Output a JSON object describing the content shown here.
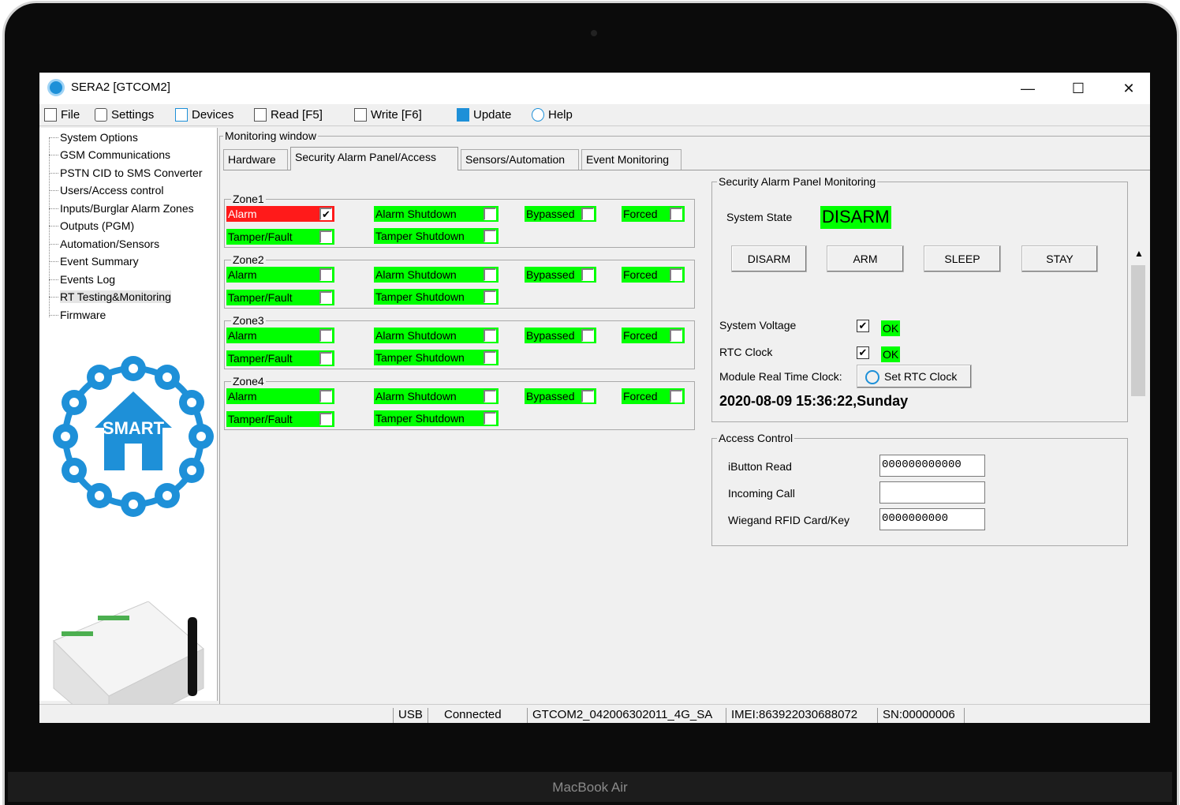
{
  "window": {
    "title": "SERA2 [GTCOM2]",
    "minimize": "—",
    "maximize": "☐",
    "close": "✕"
  },
  "menu": [
    {
      "label": "File",
      "icon": "file-icon"
    },
    {
      "label": "Settings",
      "icon": "settings-icon"
    },
    {
      "label": "Devices",
      "icon": "devices-icon"
    },
    {
      "label": "Read [F5]",
      "icon": "read-icon"
    },
    {
      "label": "Write [F6]",
      "icon": "write-icon"
    },
    {
      "label": "Update",
      "icon": "update-icon"
    },
    {
      "label": "Help",
      "icon": "help-icon"
    }
  ],
  "tree": [
    "System Options",
    "GSM Communications",
    "PSTN CID to SMS Converter",
    "Users/Access control",
    "Inputs/Burglar Alarm Zones",
    "Outputs (PGM)",
    "Automation/Sensors",
    "Event Summary",
    "Events Log",
    "RT Testing&Monitoring",
    "Firmware"
  ],
  "logo": {
    "text": "SMART"
  },
  "monitor": {
    "title": "Monitoring window"
  },
  "tabs": [
    "Hardware",
    "Security Alarm Panel/Access",
    "Sensors/Automation",
    "Event Monitoring"
  ],
  "zones": [
    {
      "name": "Zone1",
      "alarm": "Alarm",
      "alarm_checked": "✔",
      "tamper": "Tamper/Fault",
      "alarm_shutdown": "Alarm Shutdown",
      "tamper_shutdown": "Tamper Shutdown",
      "bypassed": "Bypassed",
      "forced": "Forced"
    },
    {
      "name": "Zone2",
      "alarm": "Alarm",
      "alarm_checked": "",
      "tamper": "Tamper/Fault",
      "alarm_shutdown": "Alarm Shutdown",
      "tamper_shutdown": "Tamper Shutdown",
      "bypassed": "Bypassed",
      "forced": "Forced"
    },
    {
      "name": "Zone3",
      "alarm": "Alarm",
      "alarm_checked": "",
      "tamper": "Tamper/Fault",
      "alarm_shutdown": "Alarm Shutdown",
      "tamper_shutdown": "Tamper Shutdown",
      "bypassed": "Bypassed",
      "forced": "Forced"
    },
    {
      "name": "Zone4",
      "alarm": "Alarm",
      "alarm_checked": "",
      "tamper": "Tamper/Fault",
      "alarm_shutdown": "Alarm Shutdown",
      "tamper_shutdown": "Tamper Shutdown",
      "bypassed": "Bypassed",
      "forced": "Forced"
    }
  ],
  "panel": {
    "title": "Security Alarm Panel Monitoring",
    "state_label": "System State",
    "state_value": "DISARM",
    "buttons": [
      "DISARM",
      "ARM",
      "SLEEP",
      "STAY"
    ],
    "voltage_label": "System Voltage",
    "voltage_checked": "✔",
    "voltage_value": "OK",
    "rtc_label": "RTC Clock",
    "rtc_checked": "✔",
    "rtc_value": "OK",
    "module_clock_label": "Module Real Time Clock:",
    "set_rtc": "Set RTC Clock",
    "datetime": "2020-08-09 15:36:22,Sunday"
  },
  "access": {
    "title": "Access Control",
    "ibutton_label": "iButton Read",
    "ibutton_value": "000000000000",
    "call_label": "Incoming Call",
    "call_value": "",
    "wiegand_label": "Wiegand RFID Card/Key",
    "wiegand_value": "0000000000"
  },
  "status": [
    "USB",
    "Connected",
    "GTCOM2_042006302011_4G_SA",
    "IMEI:863922030688072",
    "SN:00000006"
  ],
  "laptop": {
    "brand": "MacBook Air"
  },
  "colors": {
    "green": "#00ff00",
    "red": "#ff1a1a",
    "accent": "#1e90d8"
  }
}
